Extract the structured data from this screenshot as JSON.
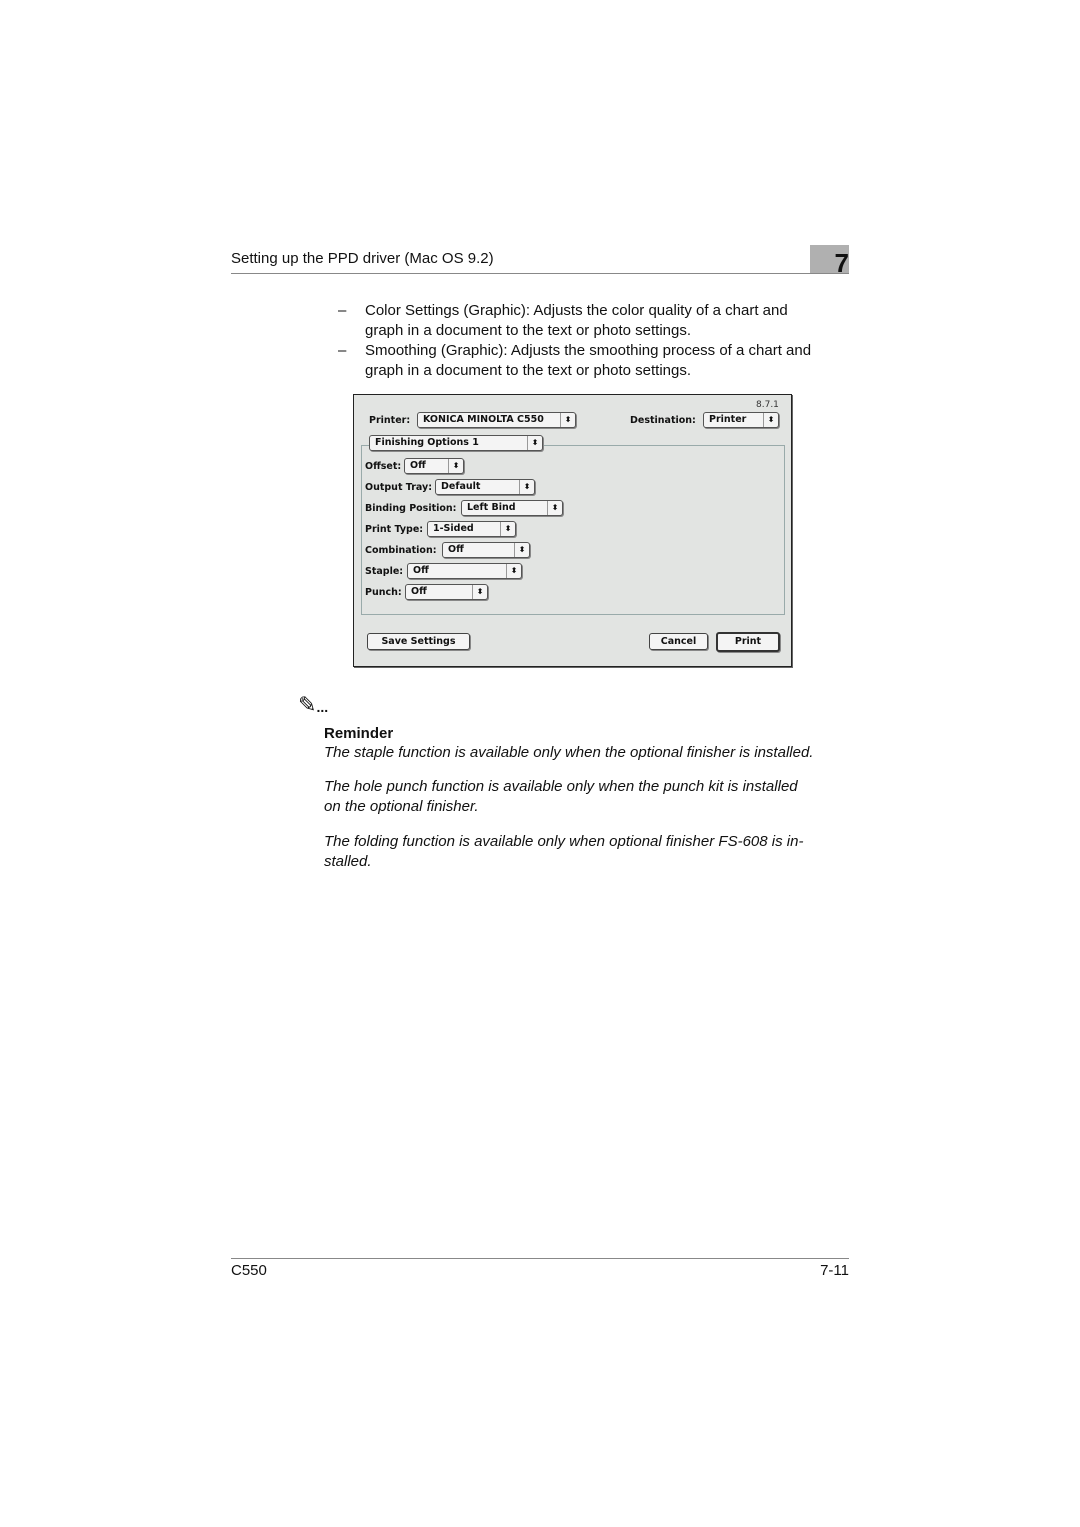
{
  "header": {
    "title": "Setting up the PPD driver (Mac OS 9.2)",
    "chapter": "7"
  },
  "bullets": [
    {
      "dash": "–",
      "line1": "Color Settings (Graphic): Adjusts the color quality of a chart and",
      "line2": "graph in a document to the text or photo settings."
    },
    {
      "dash": "–",
      "line1": "Smoothing (Graphic): Adjusts the smoothing process of a chart and",
      "line2": "graph in a document to the text or photo settings."
    }
  ],
  "dialog": {
    "version": "8.7.1",
    "printer_label": "Printer:",
    "printer_value": "KONICA MINOLTA C550",
    "destination_label": "Destination:",
    "destination_value": "Printer",
    "panel": "Finishing Options 1",
    "fields": [
      {
        "label": "Offset:",
        "value": "Off"
      },
      {
        "label": "Output Tray:",
        "value": "Default"
      },
      {
        "label": "Binding Position:",
        "value": "Left Bind"
      },
      {
        "label": "Print Type:",
        "value": "1-Sided"
      },
      {
        "label": "Combination:",
        "value": "Off"
      },
      {
        "label": "Staple:",
        "value": "Off"
      },
      {
        "label": "Punch:",
        "value": "Off"
      }
    ],
    "save": "Save Settings",
    "cancel": "Cancel",
    "print": "Print",
    "arrow": "⬍"
  },
  "reminder": {
    "icon": "pencil-note-icon",
    "dots": "...",
    "title": "Reminder",
    "p1": "The staple function is available only when the optional finisher is installed.",
    "p2a": "The hole punch function is available only when the punch kit is installed",
    "p2b": "on the optional finisher.",
    "p3a": "The folding function is available only when optional finisher FS-608 is in-",
    "p3b": "stalled."
  },
  "footer": {
    "model": "C550",
    "page": "7-11"
  }
}
